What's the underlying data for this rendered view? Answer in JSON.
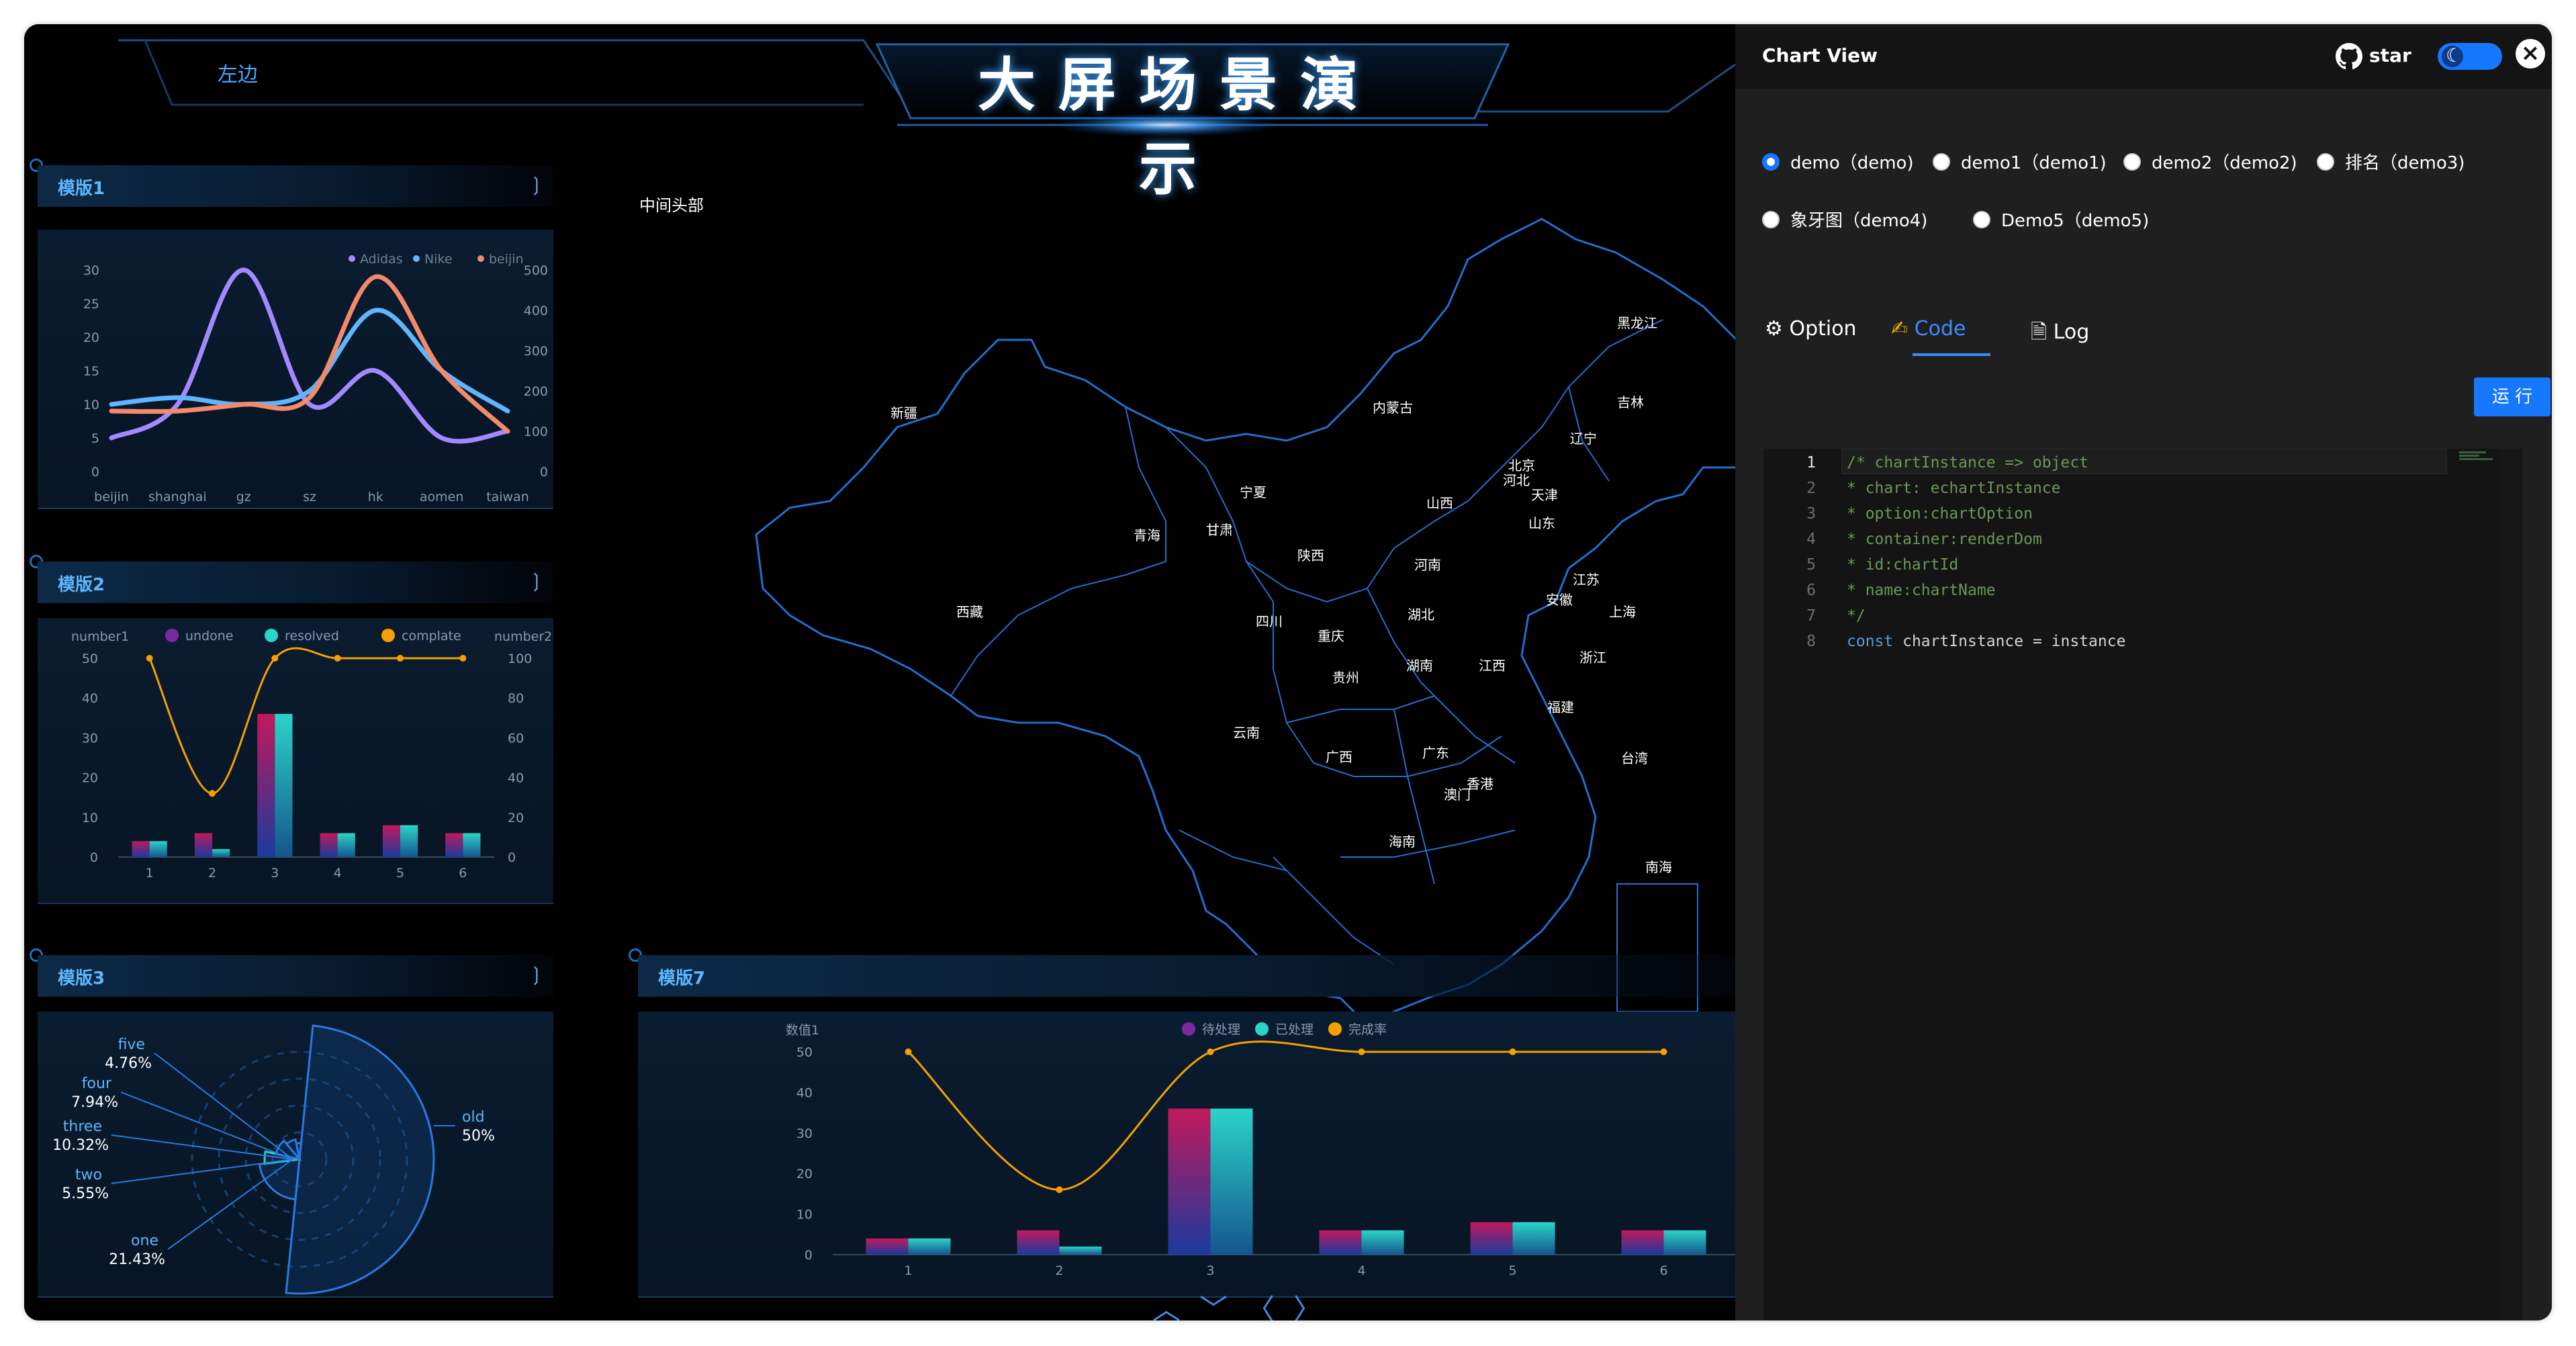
{
  "header": {
    "title": "大屏场景演示",
    "left_tab": "左边"
  },
  "middle_header": "中间头部",
  "panels": {
    "p1": {
      "title": "模版1"
    },
    "p2": {
      "title": "模版2"
    },
    "p3": {
      "title": "模版3"
    },
    "p7": {
      "title": "模版7"
    }
  },
  "pager_icons": [
    "chevron-up-icon",
    "chevron-down-icon",
    "chevron-left-icon",
    "chevron-right-icon"
  ],
  "chart_data": [
    {
      "type": "line",
      "panel": "模版1",
      "categories": [
        "beijin",
        "shanghai",
        "gz",
        "sz",
        "hk",
        "aomen",
        "taiwan"
      ],
      "y_left_ticks": [
        0,
        5,
        10,
        15,
        20,
        25,
        30
      ],
      "y_right_ticks": [
        0,
        100,
        200,
        300,
        400,
        500
      ],
      "series": [
        {
          "name": "Adidas",
          "values": [
            5,
            10,
            30,
            10,
            15,
            5,
            6
          ],
          "color": "#a389ff"
        },
        {
          "name": "Nike",
          "values": [
            10,
            11,
            10,
            12,
            24,
            15,
            9
          ],
          "color": "#5fb6ff"
        },
        {
          "name": "beijin",
          "values": [
            9,
            9,
            10,
            11,
            29,
            15,
            6
          ],
          "color": "#f28a6b"
        }
      ],
      "smooth": true
    },
    {
      "type": "bar",
      "panel": "模版2",
      "categories": [
        "1",
        "2",
        "3",
        "4",
        "5",
        "6"
      ],
      "y_left_label": "number1",
      "y_right_label": "number2",
      "y_left_ticks": [
        0,
        10,
        20,
        30,
        40,
        50
      ],
      "y_right_ticks": [
        0,
        20,
        40,
        60,
        80,
        100
      ],
      "series": [
        {
          "name": "undone",
          "values": [
            4,
            6,
            36,
            6,
            8,
            6
          ]
        },
        {
          "name": "resolved",
          "values": [
            4,
            2,
            36,
            6,
            8,
            6
          ]
        },
        {
          "name": "complate",
          "values": [
            100,
            32,
            100,
            100,
            100,
            100
          ],
          "type": "line",
          "color": "#f5a000"
        }
      ]
    },
    {
      "type": "pie",
      "panel": "模版3",
      "rose": true,
      "slices": [
        {
          "label": "old",
          "value": 50,
          "display": "50%"
        },
        {
          "label": "one",
          "value": 21.43,
          "display": "21.43%"
        },
        {
          "label": "two",
          "value": 5.55,
          "display": "5.55%"
        },
        {
          "label": "three",
          "value": 10.32,
          "display": "10.32%"
        },
        {
          "label": "four",
          "value": 7.94,
          "display": "7.94%"
        },
        {
          "label": "five",
          "value": 4.76,
          "display": "4.76%"
        }
      ]
    },
    {
      "type": "bar",
      "panel": "模版7",
      "categories": [
        "1",
        "2",
        "3",
        "4",
        "5",
        "6"
      ],
      "y_left_label": "数值1",
      "y_left_ticks": [
        0,
        10,
        20,
        30,
        40,
        50
      ],
      "series": [
        {
          "name": "待处理",
          "values": [
            4,
            6,
            36,
            6,
            8,
            6
          ]
        },
        {
          "name": "已处理",
          "values": [
            4,
            2,
            36,
            6,
            8,
            6
          ]
        },
        {
          "name": "完成率",
          "values": [
            100,
            32,
            100,
            100,
            100,
            100
          ],
          "type": "line",
          "color": "#f5a000"
        }
      ]
    }
  ],
  "map": {
    "provinces": [
      {
        "name": "新疆"
      },
      {
        "name": "西藏"
      },
      {
        "name": "青海"
      },
      {
        "name": "甘肃"
      },
      {
        "name": "宁夏"
      },
      {
        "name": "内蒙古"
      },
      {
        "name": "黑龙江"
      },
      {
        "name": "吉林"
      },
      {
        "name": "辽宁"
      },
      {
        "name": "北京"
      },
      {
        "name": "河北"
      },
      {
        "name": "天津"
      },
      {
        "name": "山西"
      },
      {
        "name": "山东"
      },
      {
        "name": "陕西"
      },
      {
        "name": "河南"
      },
      {
        "name": "江苏"
      },
      {
        "name": "安徽"
      },
      {
        "name": "上海"
      },
      {
        "name": "湖北"
      },
      {
        "name": "四川"
      },
      {
        "name": "重庆"
      },
      {
        "name": "浙江"
      },
      {
        "name": "贵州"
      },
      {
        "name": "湖南"
      },
      {
        "name": "江西"
      },
      {
        "name": "福建"
      },
      {
        "name": "云南"
      },
      {
        "name": "广西"
      },
      {
        "name": "广东"
      },
      {
        "name": "台湾"
      },
      {
        "name": "香港"
      },
      {
        "name": "澳门"
      },
      {
        "name": "海南"
      },
      {
        "name": "南海"
      }
    ]
  },
  "side_panel": {
    "title": "Chart View",
    "star_label": "star",
    "run_label": "运 行",
    "radios": [
      {
        "label": "demo（demo)",
        "checked": true
      },
      {
        "label": "demo1（demo1)",
        "checked": false
      },
      {
        "label": "demo2（demo2)",
        "checked": false
      },
      {
        "label": "排名（demo3)",
        "checked": false
      },
      {
        "label": "象牙图（demo4)",
        "checked": false
      },
      {
        "label": "Demo5（demo5)",
        "checked": false
      }
    ],
    "tabs": [
      {
        "label": "Option",
        "icon": "gear-icon",
        "active": false
      },
      {
        "label": "Code",
        "icon": "edit-icon",
        "active": true
      },
      {
        "label": "Log",
        "icon": "file-icon",
        "active": false
      }
    ],
    "code_lines": [
      {
        "n": "1",
        "text": "/* chartInstance => object",
        "cls": "c-comment"
      },
      {
        "n": "2",
        "text": "* chart: echartInstance",
        "cls": "c-comment"
      },
      {
        "n": "3",
        "text": "* option:chartOption",
        "cls": "c-comment"
      },
      {
        "n": "4",
        "text": "* container:renderDom",
        "cls": "c-comment"
      },
      {
        "n": "5",
        "text": "* id:chartId",
        "cls": "c-comment"
      },
      {
        "n": "6",
        "text": "* name:chartName",
        "cls": "c-comment"
      },
      {
        "n": "7",
        "text": "*/",
        "cls": "c-comment"
      },
      {
        "n": "8",
        "text": "",
        "cls": "c-plain",
        "kw": "const",
        "rest": " chartInstance = instance"
      }
    ]
  },
  "colors": {
    "accent": "#1677ff",
    "map_line": "#1f6fd1",
    "panel_label": "#5db7ff"
  }
}
